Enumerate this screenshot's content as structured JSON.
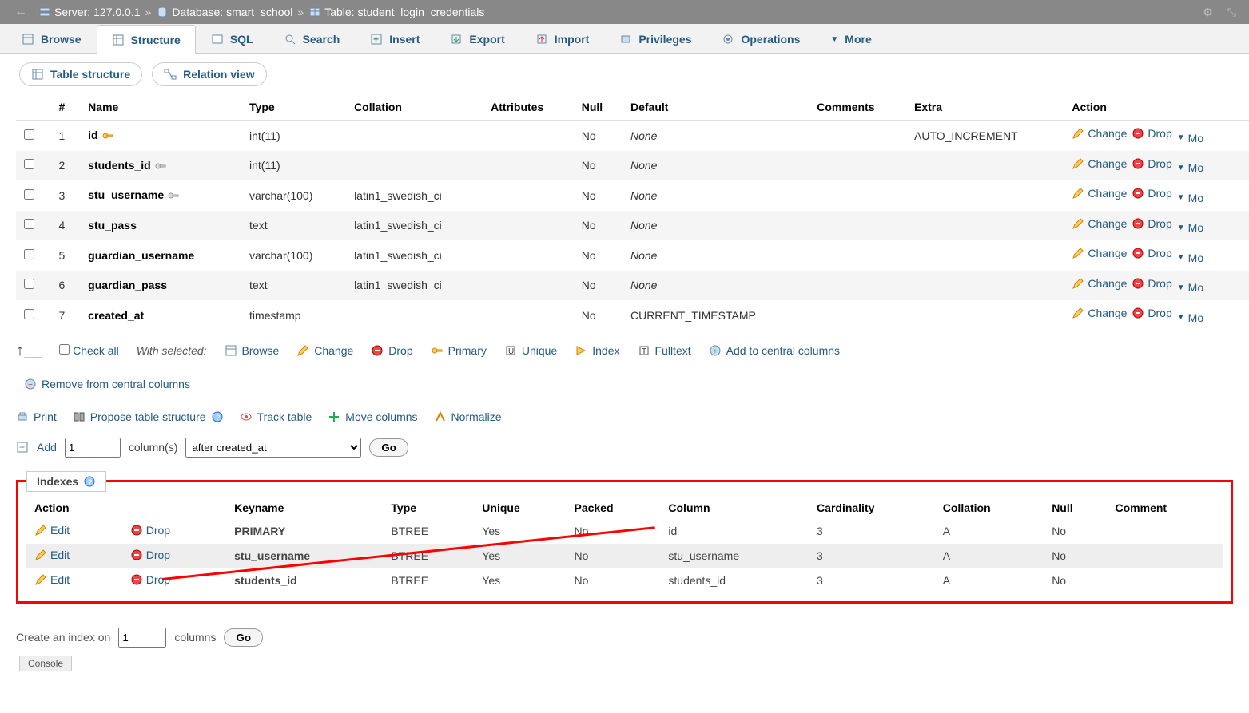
{
  "breadcrumb": {
    "server_label": "Server:",
    "server_value": "127.0.0.1",
    "db_label": "Database:",
    "db_value": "smart_school",
    "table_label": "Table:",
    "table_value": "student_login_credentials"
  },
  "tabs": [
    {
      "label": "Browse",
      "icon": "browse"
    },
    {
      "label": "Structure",
      "icon": "structure",
      "active": true
    },
    {
      "label": "SQL",
      "icon": "sql"
    },
    {
      "label": "Search",
      "icon": "search"
    },
    {
      "label": "Insert",
      "icon": "insert"
    },
    {
      "label": "Export",
      "icon": "export"
    },
    {
      "label": "Import",
      "icon": "import"
    },
    {
      "label": "Privileges",
      "icon": "privileges"
    },
    {
      "label": "Operations",
      "icon": "operations"
    },
    {
      "label": "More",
      "icon": "more"
    }
  ],
  "subtabs": {
    "table_structure": "Table structure",
    "relation_view": "Relation view"
  },
  "cols_headers": {
    "num": "#",
    "name": "Name",
    "type": "Type",
    "collation": "Collation",
    "attributes": "Attributes",
    "null": "Null",
    "default": "Default",
    "comments": "Comments",
    "extra": "Extra",
    "action": "Action"
  },
  "columns": [
    {
      "n": "1",
      "name": "id",
      "key": "primary",
      "type": "int(11)",
      "collation": "",
      "null": "No",
      "default": "None",
      "extra": "AUTO_INCREMENT",
      "default_italic": true
    },
    {
      "n": "2",
      "name": "students_id",
      "key": "index",
      "type": "int(11)",
      "collation": "",
      "null": "No",
      "default": "None",
      "extra": "",
      "default_italic": true
    },
    {
      "n": "3",
      "name": "stu_username",
      "key": "index",
      "type": "varchar(100)",
      "collation": "latin1_swedish_ci",
      "null": "No",
      "default": "None",
      "extra": "",
      "default_italic": true
    },
    {
      "n": "4",
      "name": "stu_pass",
      "key": "",
      "type": "text",
      "collation": "latin1_swedish_ci",
      "null": "No",
      "default": "None",
      "extra": "",
      "default_italic": true
    },
    {
      "n": "5",
      "name": "guardian_username",
      "key": "",
      "type": "varchar(100)",
      "collation": "latin1_swedish_ci",
      "null": "No",
      "default": "None",
      "extra": "",
      "default_italic": true
    },
    {
      "n": "6",
      "name": "guardian_pass",
      "key": "",
      "type": "text",
      "collation": "latin1_swedish_ci",
      "null": "No",
      "default": "None",
      "extra": "",
      "default_italic": true
    },
    {
      "n": "7",
      "name": "created_at",
      "key": "",
      "type": "timestamp",
      "collation": "",
      "null": "No",
      "default": "CURRENT_TIMESTAMP",
      "extra": "",
      "default_italic": false
    }
  ],
  "action_labels": {
    "change": "Change",
    "drop": "Drop",
    "more": "Mo"
  },
  "check_all": "Check all",
  "with_selected": "With selected:",
  "bulk_actions": {
    "browse": "Browse",
    "change": "Change",
    "drop": "Drop",
    "primary": "Primary",
    "unique": "Unique",
    "index": "Index",
    "fulltext": "Fulltext",
    "add_central": "Add to central columns",
    "remove_central": "Remove from central columns"
  },
  "toolbar2": {
    "print": "Print",
    "propose": "Propose table structure",
    "track": "Track table",
    "move": "Move columns",
    "normalize": "Normalize"
  },
  "addrow": {
    "add": "Add",
    "count": "1",
    "cols_label": "column(s)",
    "position": "after created_at",
    "go": "Go"
  },
  "indexes": {
    "title": "Indexes",
    "headers": {
      "action": "Action",
      "keyname": "Keyname",
      "type": "Type",
      "unique": "Unique",
      "packed": "Packed",
      "column": "Column",
      "card": "Cardinality",
      "coll": "Collation",
      "null": "Null",
      "comment": "Comment"
    },
    "rows": [
      {
        "keyname": "PRIMARY",
        "type": "BTREE",
        "unique": "Yes",
        "packed": "No",
        "column": "id",
        "card": "3",
        "coll": "A",
        "null": "No",
        "comment": ""
      },
      {
        "keyname": "stu_username",
        "type": "BTREE",
        "unique": "Yes",
        "packed": "No",
        "column": "stu_username",
        "card": "3",
        "coll": "A",
        "null": "No",
        "comment": ""
      },
      {
        "keyname": "students_id",
        "type": "BTREE",
        "unique": "Yes",
        "packed": "No",
        "column": "students_id",
        "card": "3",
        "coll": "A",
        "null": "No",
        "comment": ""
      }
    ],
    "edit": "Edit",
    "drop": "Drop"
  },
  "create_index": {
    "label": "Create an index on",
    "count": "1",
    "cols": "columns",
    "go": "Go"
  },
  "console": "Console"
}
